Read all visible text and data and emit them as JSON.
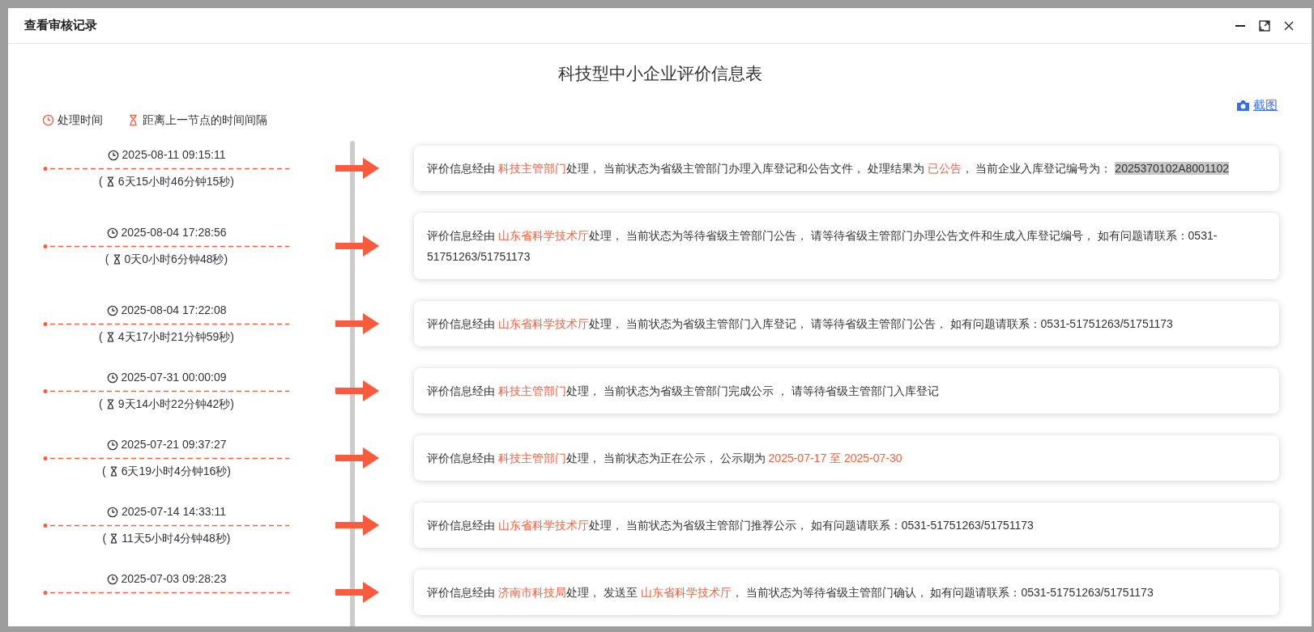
{
  "dialog": {
    "title": "查看审核记录",
    "heading": "科技型中小企业评价信息表",
    "screenshot_link": "截图",
    "legend": [
      {
        "kind": "time",
        "label": "处理时间"
      },
      {
        "kind": "interval",
        "label": "距离上一节点的时间间隔"
      }
    ],
    "records": [
      {
        "time": "2025-08-11 09:15:11",
        "interval_prefix": "(",
        "interval": "6天15小时46分钟15秒)",
        "segments": [
          {
            "kind": "plain",
            "text": "评价信息经由 "
          },
          {
            "kind": "highlight",
            "text": "科技主管部门"
          },
          {
            "kind": "plain",
            "text": "处理， 当前状态为省级主管部门办理入库登记和公告文件， 处理结果为 "
          },
          {
            "kind": "highlight",
            "text": "已公告"
          },
          {
            "kind": "plain",
            "text": "， 当前企业入库登记编号为： "
          },
          {
            "kind": "marked",
            "text": "2025370102A8001102"
          }
        ]
      },
      {
        "time": "2025-08-04 17:28:56",
        "interval_prefix": "(",
        "interval": "0天0小时6分钟48秒)",
        "segments": [
          {
            "kind": "plain",
            "text": "评价信息经由 "
          },
          {
            "kind": "highlight",
            "text": "山东省科学技术厅"
          },
          {
            "kind": "plain",
            "text": "处理， 当前状态为等待省级主管部门公告， 请等待省级主管部门办理公告文件和生成入库登记编号， 如有问题请联系：0531-51751263/51751173"
          }
        ]
      },
      {
        "time": "2025-08-04 17:22:08",
        "interval_prefix": "(",
        "interval": "4天17小时21分钟59秒)",
        "segments": [
          {
            "kind": "plain",
            "text": "评价信息经由 "
          },
          {
            "kind": "highlight",
            "text": "山东省科学技术厅"
          },
          {
            "kind": "plain",
            "text": "处理， 当前状态为省级主管部门入库登记， 请等待省级主管部门公告， 如有问题请联系：0531-51751263/51751173"
          }
        ]
      },
      {
        "time": "2025-07-31 00:00:09",
        "interval_prefix": "(",
        "interval": "9天14小时22分钟42秒)",
        "segments": [
          {
            "kind": "plain",
            "text": "评价信息经由 "
          },
          {
            "kind": "highlight",
            "text": "科技主管部门"
          },
          {
            "kind": "plain",
            "text": "处理， 当前状态为省级主管部门完成公示 ， 请等待省级主管部门入库登记"
          }
        ]
      },
      {
        "time": "2025-07-21 09:37:27",
        "interval_prefix": "(",
        "interval": "6天19小时4分钟16秒)",
        "segments": [
          {
            "kind": "plain",
            "text": "评价信息经由 "
          },
          {
            "kind": "highlight",
            "text": "科技主管部门"
          },
          {
            "kind": "plain",
            "text": "处理， 当前状态为正在公示， 公示期为 "
          },
          {
            "kind": "highlight",
            "text": "2025-07-17 至 2025-07-30"
          }
        ]
      },
      {
        "time": "2025-07-14 14:33:11",
        "interval_prefix": "(",
        "interval": "11天5小时4分钟48秒)",
        "segments": [
          {
            "kind": "plain",
            "text": "评价信息经由 "
          },
          {
            "kind": "highlight",
            "text": "山东省科学技术厅"
          },
          {
            "kind": "plain",
            "text": "处理， 当前状态为省级主管部门推荐公示， 如有问题请联系：0531-51751263/51751173"
          }
        ]
      },
      {
        "time": "2025-07-03 09:28:23",
        "segments": [
          {
            "kind": "plain",
            "text": "评价信息经由 "
          },
          {
            "kind": "highlight",
            "text": "济南市科技局"
          },
          {
            "kind": "plain",
            "text": "处理， 发送至 "
          },
          {
            "kind": "highlight",
            "text": "山东省科学技术厅"
          },
          {
            "kind": "plain",
            "text": "， 当前状态为等待省级主管部门确认， 如有问题请联系：0531-51751263/51751173"
          }
        ]
      }
    ]
  }
}
